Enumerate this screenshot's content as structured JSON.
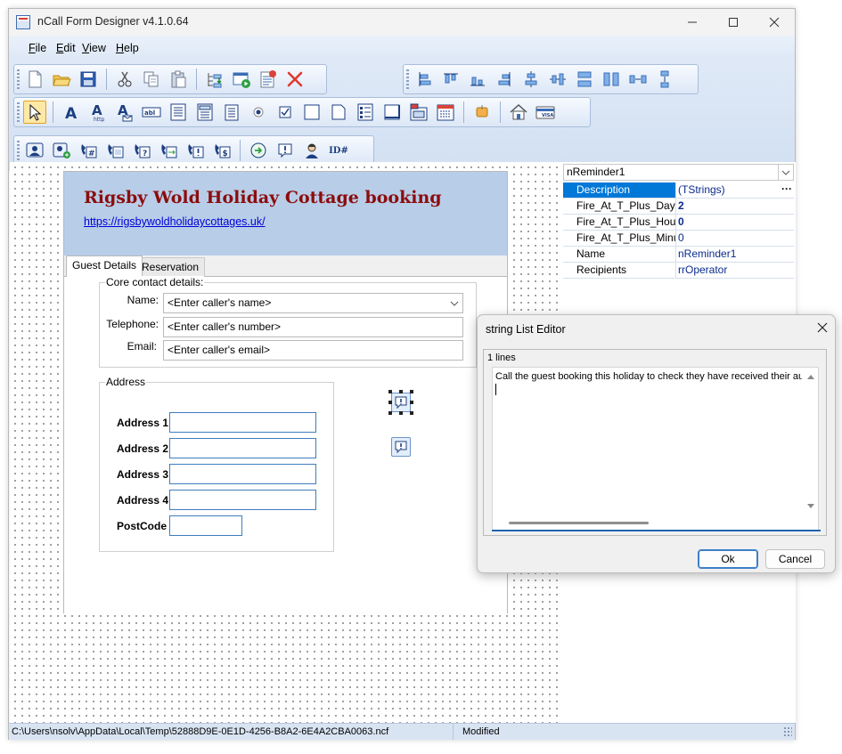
{
  "window": {
    "title": "nCall Form Designer v4.1.0.64",
    "controls": [
      "minimize-icon",
      "maximize-icon",
      "close-icon"
    ]
  },
  "menu": [
    {
      "label": "File"
    },
    {
      "label": "Edit"
    },
    {
      "label": "View"
    },
    {
      "label": "Help"
    }
  ],
  "toolbars": {
    "file": [
      "new-file-icon",
      "open-folder-icon",
      "save-icon",
      "cut-icon",
      "copy-icon",
      "paste-icon",
      "move-down-icon",
      "run-form-icon",
      "properties-icon",
      "delete-icon"
    ],
    "align": [
      "align-left-icon",
      "align-top-icon",
      "align-bottom-icon",
      "align-right-icon",
      "align-center-vertical-icon",
      "align-center-horizontal-icon",
      "same-width-icon",
      "same-height-icon",
      "space-horizontal-icon",
      "space-vertical-icon"
    ],
    "controls": [
      "pointer-icon",
      "label-icon",
      "hyperlink-icon",
      "email-label-icon",
      "text-box-icon",
      "memo-icon",
      "combo-box-icon",
      "list-box-icon",
      "radio-button-icon",
      "checkbox-icon",
      "panel-icon",
      "page-icon",
      "group-list-icon",
      "frame-icon",
      "tab-control-icon",
      "calendar-icon",
      "button-icon",
      "home-icon",
      "card-icon"
    ],
    "actions": [
      "contact-icon",
      "add-contact-icon",
      "phone-number-icon",
      "phone-data-icon",
      "phone-question-icon",
      "phone-transfer-icon",
      "phone-alert-icon",
      "phone-payment-icon",
      "go-icon",
      "reminder-icon",
      "operator-icon",
      "id-icon"
    ],
    "id_label": "ID#"
  },
  "form": {
    "title": "Rigsby Wold Holiday Cottage booking",
    "link": "https://rigsbywoldholidaycottages.uk/",
    "tabs": [
      {
        "label": "Guest Details"
      },
      {
        "label": "Reservation"
      }
    ],
    "contact_group": {
      "caption": "Core contact details:",
      "fields": [
        {
          "label": "Name:",
          "value": "<Enter caller's name>"
        },
        {
          "label": "Telephone:",
          "value": "<Enter caller's number>"
        },
        {
          "label": "Email:",
          "value": "<Enter caller's email>"
        }
      ]
    },
    "address_group": {
      "caption": "Address",
      "fields": [
        {
          "label": "Address 1"
        },
        {
          "label": "Address 2"
        },
        {
          "label": "Address 3"
        },
        {
          "label": "Address 4"
        },
        {
          "label": "PostCode"
        }
      ]
    },
    "reminder_icons": [
      "reminder-icon",
      "reminder-icon"
    ]
  },
  "properties": {
    "selected_component": "nReminder1",
    "rows": [
      {
        "key": "Description",
        "value": "(TStrings)",
        "selected": true
      },
      {
        "key": "Fire_At_T_Plus_Days",
        "value": "2"
      },
      {
        "key": "Fire_At_T_Plus_Hours",
        "value": "0"
      },
      {
        "key": "Fire_At_T_Plus_Minutes",
        "value": "0"
      },
      {
        "key": "Name",
        "value": "nReminder1"
      },
      {
        "key": "Recipients",
        "value": "rrOperator"
      }
    ],
    "ellipsis": "···"
  },
  "status": {
    "path": "C:\\Users\\nsolv\\AppData\\Local\\Temp\\52888D9E-0E1D-4256-B8A2-6E4A2CBA0063.ncf",
    "state": "Modified"
  },
  "dialog": {
    "title": "string List Editor",
    "lines": "1 lines",
    "text": "Call the guest booking this holiday to check they have received their automated confirmation",
    "ok": "Ok",
    "cancel": "Cancel"
  },
  "colors": {
    "accent": "#0078d7",
    "form_title": "#8b0d0d",
    "header_band": "#b8cde8",
    "link": "#0000d8"
  }
}
